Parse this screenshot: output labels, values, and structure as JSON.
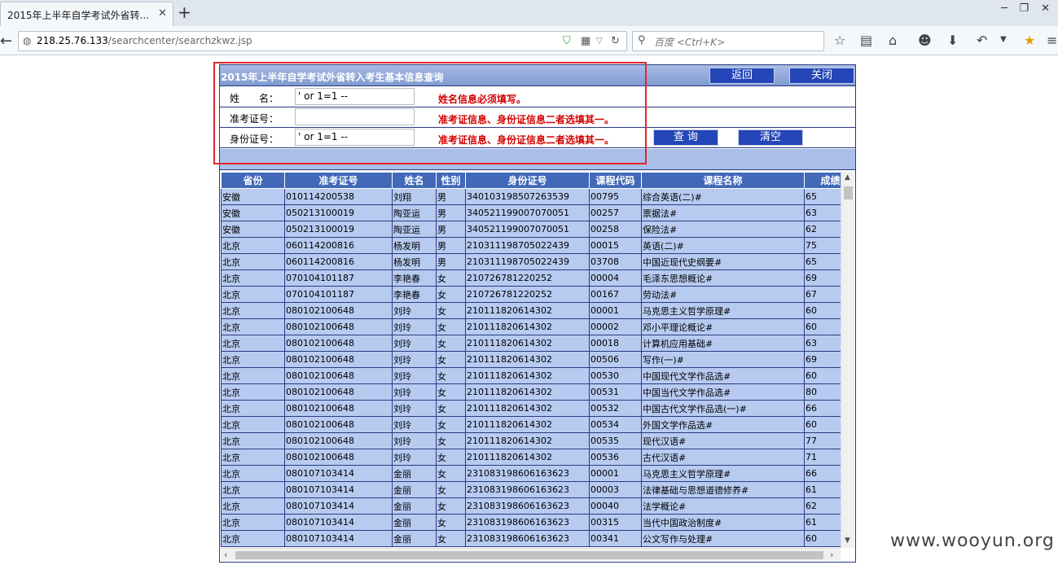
{
  "browser": {
    "tab_title": "2015年上半年自学考试外省转...",
    "url_host": "218.25.76.133",
    "url_path": "/searchcenter/searchzkwz.jsp",
    "search_placeholder": "百度 <Ctrl+K>"
  },
  "form": {
    "title": "2015年上半年自学考试外省转入考生基本信息查询",
    "back_label": "返回",
    "close_label": "关闭",
    "name_label": "姓　　名：",
    "name_value": "' or 1=1 --",
    "name_note": "姓名信息必须填写。",
    "exam_label": "准考证号：",
    "exam_value": "",
    "exam_note": "准考证信息、身份证信息二者选填其一。",
    "id_label": "身份证号：",
    "id_value": "' or 1=1 --",
    "id_note": "准考证信息、身份证信息二者选填其一。",
    "query_label": "查 询",
    "clear_label": "清空"
  },
  "grid": {
    "headers": [
      "省份",
      "准考证号",
      "姓名",
      "性别",
      "身份证号",
      "课程代码",
      "课程名称",
      "成绩"
    ],
    "rows": [
      [
        "安徽",
        "010114200538",
        "刘翔",
        "男",
        "340103198507263539",
        "00795",
        "综合英语(二)#",
        "65"
      ],
      [
        "安徽",
        "050213100019",
        "陶亚运",
        "男",
        "340521199007070051",
        "00257",
        "票据法#",
        "63"
      ],
      [
        "安徽",
        "050213100019",
        "陶亚运",
        "男",
        "340521199007070051",
        "00258",
        "保险法#",
        "62"
      ],
      [
        "北京",
        "060114200816",
        "杨发明",
        "男",
        "210311198705022439",
        "00015",
        "英语(二)#",
        "75"
      ],
      [
        "北京",
        "060114200816",
        "杨发明",
        "男",
        "210311198705022439",
        "03708",
        "中国近现代史纲要#",
        "65"
      ],
      [
        "北京",
        "070104101187",
        "李艳春",
        "女",
        "210726781220252",
        "00004",
        "毛泽东思想概论#",
        "69"
      ],
      [
        "北京",
        "070104101187",
        "李艳春",
        "女",
        "210726781220252",
        "00167",
        "劳动法#",
        "67"
      ],
      [
        "北京",
        "080102100648",
        "刘玲",
        "女",
        "210111820614302",
        "00001",
        "马克思主义哲学原理#",
        "60"
      ],
      [
        "北京",
        "080102100648",
        "刘玲",
        "女",
        "210111820614302",
        "00002",
        "邓小平理论概论#",
        "60"
      ],
      [
        "北京",
        "080102100648",
        "刘玲",
        "女",
        "210111820614302",
        "00018",
        "计算机应用基础#",
        "63"
      ],
      [
        "北京",
        "080102100648",
        "刘玲",
        "女",
        "210111820614302",
        "00506",
        "写作(一)#",
        "69"
      ],
      [
        "北京",
        "080102100648",
        "刘玲",
        "女",
        "210111820614302",
        "00530",
        "中国现代文学作品选#",
        "60"
      ],
      [
        "北京",
        "080102100648",
        "刘玲",
        "女",
        "210111820614302",
        "00531",
        "中国当代文学作品选#",
        "80"
      ],
      [
        "北京",
        "080102100648",
        "刘玲",
        "女",
        "210111820614302",
        "00532",
        "中国古代文学作品选(一)#",
        "66"
      ],
      [
        "北京",
        "080102100648",
        "刘玲",
        "女",
        "210111820614302",
        "00534",
        "外国文学作品选#",
        "60"
      ],
      [
        "北京",
        "080102100648",
        "刘玲",
        "女",
        "210111820614302",
        "00535",
        "现代汉语#",
        "77"
      ],
      [
        "北京",
        "080102100648",
        "刘玲",
        "女",
        "210111820614302",
        "00536",
        "古代汉语#",
        "71"
      ],
      [
        "北京",
        "080107103414",
        "金丽",
        "女",
        "231083198606163623",
        "00001",
        "马克思主义哲学原理#",
        "66"
      ],
      [
        "北京",
        "080107103414",
        "金丽",
        "女",
        "231083198606163623",
        "00003",
        "法律基础与思想道德修养#",
        "61"
      ],
      [
        "北京",
        "080107103414",
        "金丽",
        "女",
        "231083198606163623",
        "00040",
        "法学概论#",
        "62"
      ],
      [
        "北京",
        "080107103414",
        "金丽",
        "女",
        "231083198606163623",
        "00315",
        "当代中国政治制度#",
        "61"
      ],
      [
        "北京",
        "080107103414",
        "金丽",
        "女",
        "231083198606163623",
        "00341",
        "公文写作与处理#",
        "60"
      ]
    ]
  },
  "watermark": "www.wooyun.org"
}
